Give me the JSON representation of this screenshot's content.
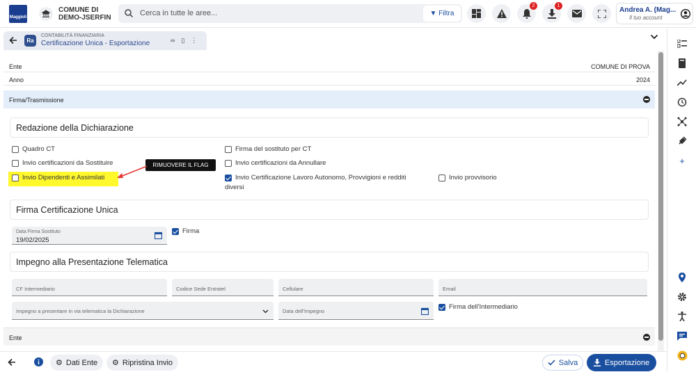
{
  "header": {
    "logo_text": "Maggioli",
    "municipality_line1": "COMUNE DI",
    "municipality_line2": "DEMO-JSERFIN",
    "search_placeholder": "Cerca in tutte le aree...",
    "filter_label": "Filtra",
    "notifications_count": "2",
    "downloads_count": "1",
    "user_name": "Andrea A. (Mag...",
    "user_sub": "Il tuo account"
  },
  "tab": {
    "logo": "Ra",
    "category": "CONTABILITÀ FINANZIARIA",
    "title": "Certificazione Unica - Esportazione"
  },
  "info": {
    "ente_label": "Ente",
    "ente_value": "COMUNE DI PROVA",
    "anno_label": "Anno",
    "anno_value": "2024"
  },
  "section_firma": {
    "title": "Firma/Trasmissione"
  },
  "redazione": {
    "title": "Redazione della Dichiarazione",
    "quadro_ct": "Quadro CT",
    "invio_sostituire": "Invio certificazioni da Sostituire",
    "invio_dipendenti": "Invio Dipendenti e Assimilati",
    "firma_sostituto_ct": "Firma del sostituto per CT",
    "invio_annullare": "Invio certificazioni da Annullare",
    "invio_lavoro_autonomo": "Invio Certificazione Lavoro Autonomo, Provvigioni e redditi diversi",
    "invio_provvisorio": "Invio provvisorio"
  },
  "annotation": {
    "callout": "RIMUOVERE IL FLAG"
  },
  "firma_cu": {
    "title": "Firma Certificazione Unica",
    "data_firma_label": "Data Firma Sostituto",
    "data_firma_value": "19/02/2025",
    "firma_label": "Firma"
  },
  "impegno": {
    "title": "Impegno alla Presentazione Telematica",
    "cf_intermediario": "CF Intermediario",
    "codice_sede": "Codice Sede Entratel",
    "cellulare": "Cellulare",
    "email": "Email",
    "impegno_select": "Impegno a presentare in via telematica la Dichiarazione",
    "data_impegno": "Data dell'Impegno",
    "firma_intermediario": "Firma dell'Intermediario"
  },
  "section_ente": {
    "title": "Ente"
  },
  "footer": {
    "dati_ente": "Dati Ente",
    "ripristina": "Ripristina Invio",
    "salva": "Salva",
    "esportazione": "Esportazione"
  },
  "colors": {
    "primary": "#1a4fa0",
    "highlight": "#fff82d",
    "section_bg": "#e3eefa",
    "annotation_arrow": "#e53935"
  }
}
